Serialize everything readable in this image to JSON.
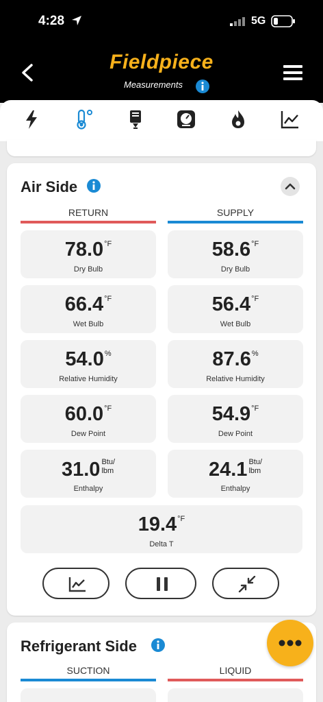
{
  "status_bar": {
    "time": "4:28",
    "network": "5G"
  },
  "header": {
    "brand": "Fieldpiece",
    "subtitle": "Measurements"
  },
  "tabs": [
    "electrical",
    "temperature",
    "pressure-probe",
    "gauge",
    "flame",
    "trend-chart"
  ],
  "colors": {
    "brand": "#f7b11b",
    "active_tab": "#1a8ad4",
    "return": "#e05a5a",
    "supply": "#1a8ad4",
    "info": "#1a8ad4"
  },
  "air_side": {
    "title": "Air Side",
    "return_label": "RETURN",
    "supply_label": "SUPPLY",
    "return": [
      {
        "value": "78.0",
        "unit": "°F",
        "label": "Dry Bulb"
      },
      {
        "value": "66.4",
        "unit": "°F",
        "label": "Wet Bulb"
      },
      {
        "value": "54.0",
        "unit": "%",
        "label": "Relative Humidity"
      },
      {
        "value": "60.0",
        "unit": "°F",
        "label": "Dew Point"
      },
      {
        "value": "31.0",
        "unit_line1": "Btu/",
        "unit_line2": "lbm",
        "label": "Enthalpy"
      }
    ],
    "supply": [
      {
        "value": "58.6",
        "unit": "°F",
        "label": "Dry Bulb"
      },
      {
        "value": "56.4",
        "unit": "°F",
        "label": "Wet Bulb"
      },
      {
        "value": "87.6",
        "unit": "%",
        "label": "Relative Humidity"
      },
      {
        "value": "54.9",
        "unit": "°F",
        "label": "Dew Point"
      },
      {
        "value": "24.1",
        "unit_line1": "Btu/",
        "unit_line2": "lbm",
        "label": "Enthalpy"
      }
    ],
    "delta_t": {
      "value": "19.4",
      "unit": "°F",
      "label": "Delta T"
    }
  },
  "refrigerant_side": {
    "title": "Refrigerant Side",
    "suction_label": "SUCTION",
    "liquid_label": "LIQUID"
  }
}
